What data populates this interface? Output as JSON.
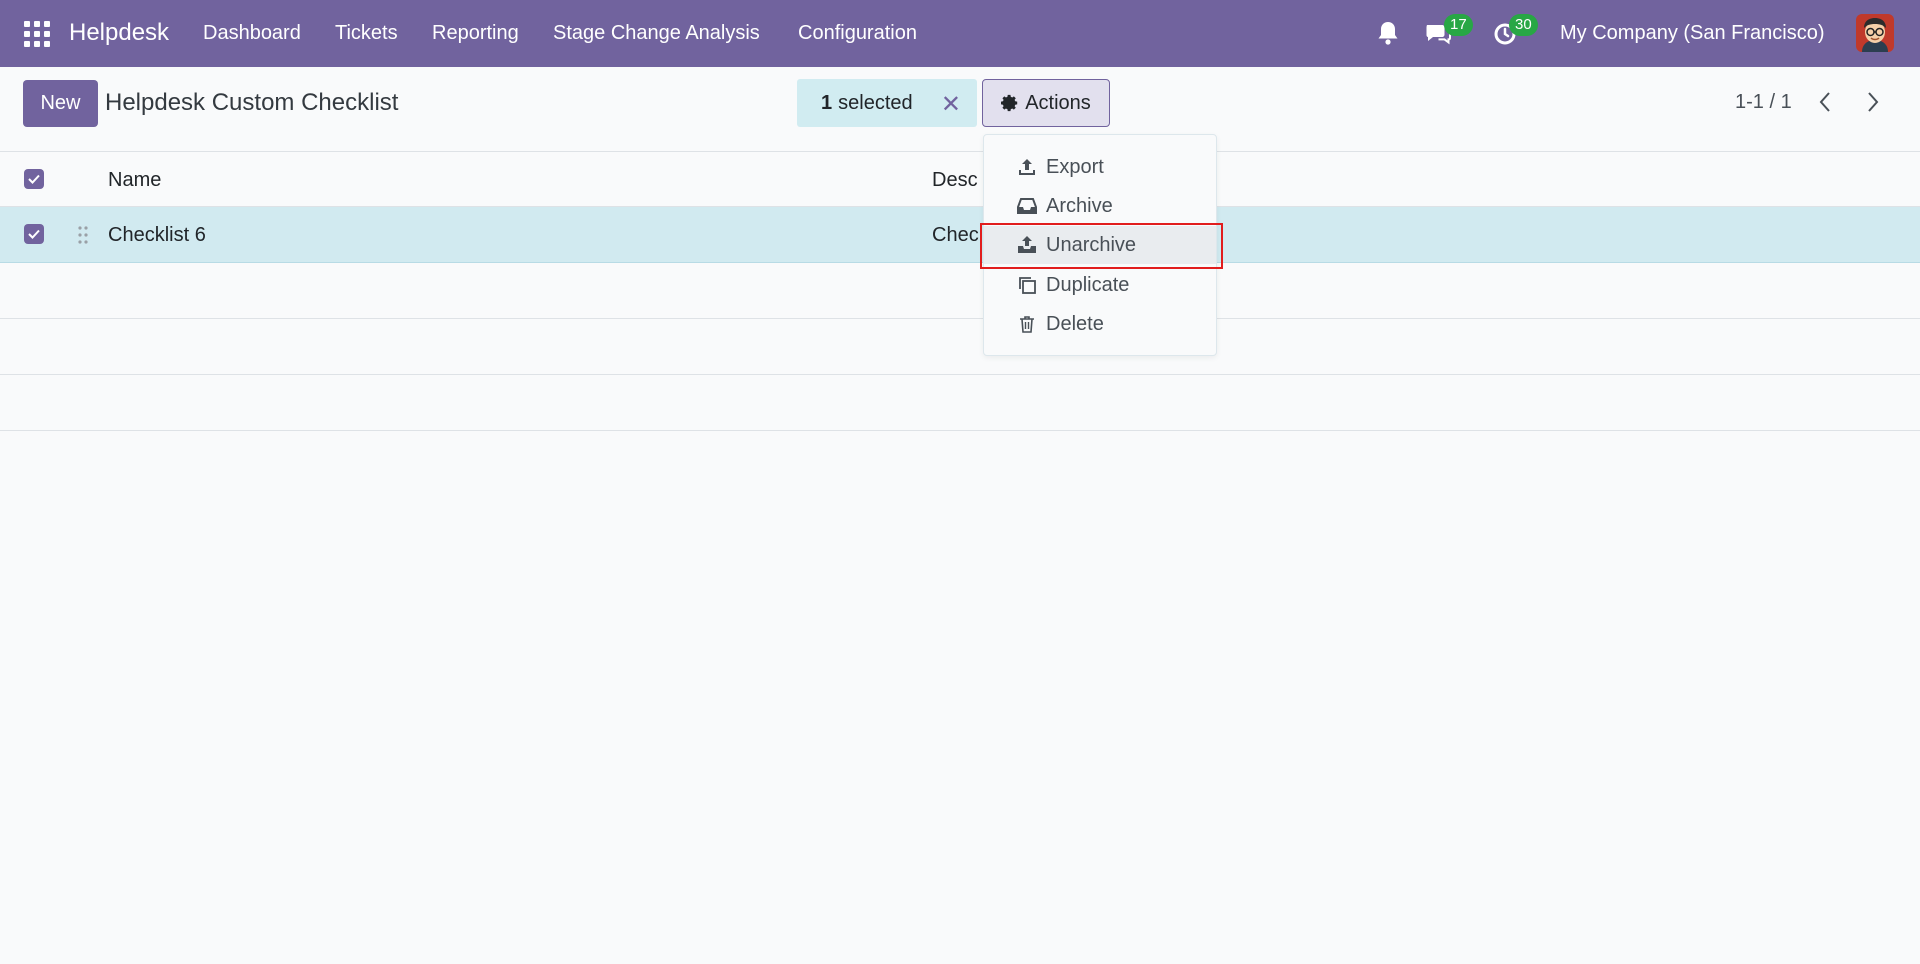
{
  "navbar": {
    "brand": "Helpdesk",
    "menu": [
      "Dashboard",
      "Tickets",
      "Reporting",
      "Stage Change Analysis",
      "Configuration"
    ],
    "messages_count": "17",
    "activities_count": "30",
    "company": "My Company (San Francisco)"
  },
  "control_panel": {
    "new_label": "New",
    "title": "Helpdesk Custom Checklist",
    "selected_count": "1",
    "selected_label": "selected",
    "actions_label": "Actions",
    "pager": "1-1 / 1"
  },
  "table": {
    "columns": [
      "Name",
      "Desc"
    ],
    "rows": [
      {
        "name": "Checklist 6",
        "description": "Chec"
      }
    ]
  },
  "actions_menu": {
    "items": [
      "Export",
      "Archive",
      "Unarchive",
      "Duplicate",
      "Delete"
    ],
    "highlighted": "Unarchive"
  },
  "colors": {
    "brand": "#71639e",
    "selected_row": "#d1eaf0",
    "badge": "#28a745",
    "highlight_frame": "#e11d1d"
  }
}
